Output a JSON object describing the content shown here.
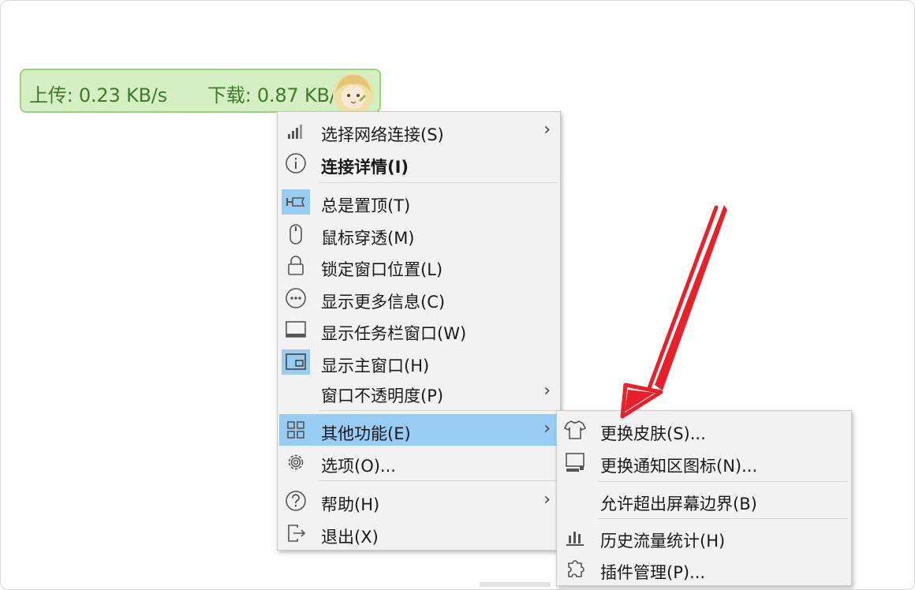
{
  "widget": {
    "upload": "上传: 0.23 KB/s",
    "download": "下载: 0.87 KB/s"
  },
  "main_menu": {
    "items": [
      {
        "label": "选择网络连接(S)",
        "icon": "signal-bars-icon",
        "submenu": true
      },
      {
        "label": "连接详情(I)",
        "icon": "info-icon",
        "bold": true
      },
      {
        "label": "总是置顶(T)",
        "icon": "pin-icon",
        "checked": true
      },
      {
        "label": "鼠标穿透(M)",
        "icon": "mouse-icon"
      },
      {
        "label": "锁定窗口位置(L)",
        "icon": "lock-icon"
      },
      {
        "label": "显示更多信息(C)",
        "icon": "more-icon"
      },
      {
        "label": "显示任务栏窗口(W)",
        "icon": "taskbar-window-icon"
      },
      {
        "label": "显示主窗口(H)",
        "icon": "main-window-icon",
        "checked": true
      },
      {
        "label": "窗口不透明度(P)",
        "icon": "",
        "submenu": true
      },
      {
        "label": "其他功能(E)",
        "icon": "grid-icon",
        "submenu": true,
        "highlighted": true
      },
      {
        "label": "选项(O)...",
        "icon": "gear-icon"
      },
      {
        "label": "帮助(H)",
        "icon": "help-icon",
        "submenu": true
      },
      {
        "label": "退出(X)",
        "icon": "exit-icon"
      }
    ],
    "submenu_arrow": "›"
  },
  "sub_menu": {
    "items": [
      {
        "label": "更换皮肤(S)...",
        "icon": "shirt-icon"
      },
      {
        "label": "更换通知区图标(N)...",
        "icon": "tray-icon"
      },
      {
        "label": "允许超出屏幕边界(B)",
        "icon": ""
      },
      {
        "label": "历史流量统计(H)",
        "icon": "bar-chart-icon"
      },
      {
        "label": "插件管理(P)...",
        "icon": "plugin-icon"
      }
    ]
  },
  "colors": {
    "widget_bg": "#d4f0c2",
    "widget_text": "#3f7a2c",
    "menu_bg": "#f2f2f2",
    "highlight": "#99ccf3",
    "annotation_arrow": "#e8202a"
  }
}
